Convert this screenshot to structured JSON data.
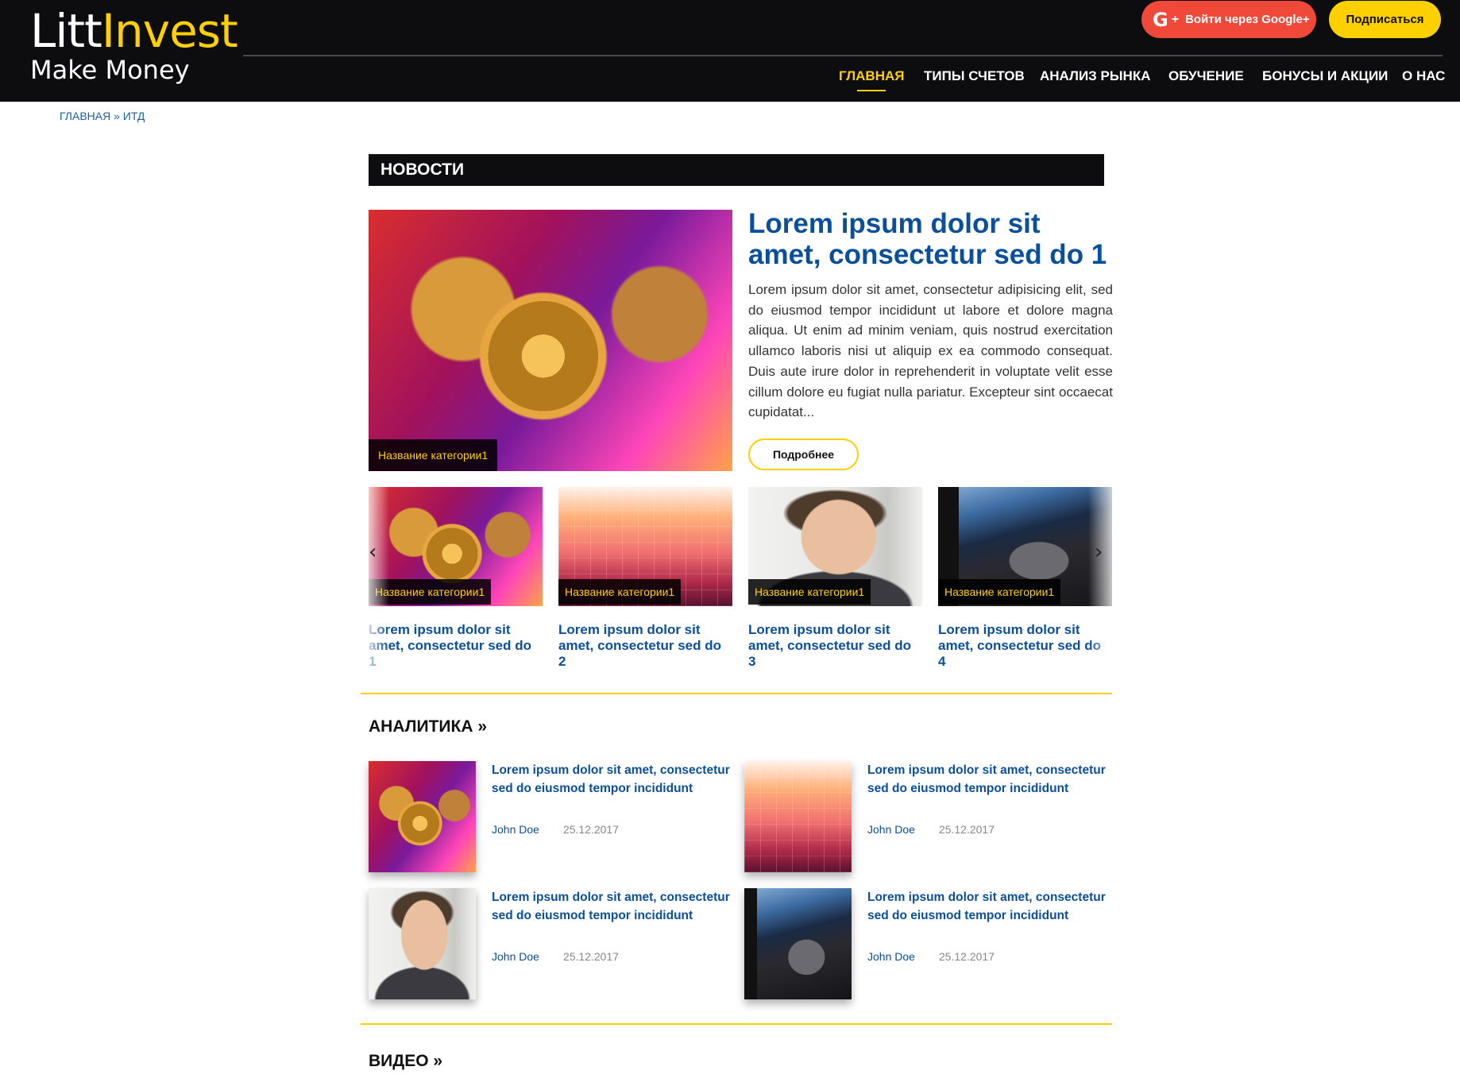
{
  "header": {
    "logo_main_1": "Litt",
    "logo_main_2": "Invest",
    "logo_sub": "Make Money",
    "google_label": "Войти через Google+",
    "google_g": "G",
    "google_plus": "+",
    "subscribe_label": "Подписаться",
    "nav": [
      {
        "label": "ГЛАВНАЯ",
        "active": true
      },
      {
        "label": "ТИПЫ СЧЕТОВ"
      },
      {
        "label": "АНАЛИЗ РЫНКА"
      },
      {
        "label": "ОБУЧЕНИЕ"
      },
      {
        "label": "БОНУСЫ И АКЦИИ"
      },
      {
        "label": "О НАС"
      }
    ]
  },
  "breadcrumb": "ГЛАВНАЯ » ИТД",
  "news": {
    "section_title": "НОВОСТИ",
    "featured": {
      "category": "Название категории1",
      "title": "Lorem ipsum dolor sit amet, consectetur sed do 1",
      "text": "Lorem ipsum dolor sit amet, consectetur adipisicing elit, sed do eiusmod tempor incididunt ut labore et dolore magna aliqua. Ut enim ad minim veniam, quis nostrud exercitation ullamco laboris nisi ut aliquip ex ea commodo consequat. Duis aute irure dolor in reprehenderit in voluptate velit esse cillum dolore eu fugiat nulla pariatur. Excepteur sint occaecat cupidatat...",
      "button": "Подробнее"
    },
    "carousel": [
      {
        "category": "Название категории1",
        "title": "Lorem ipsum dolor sit amet, consectetur sed do 1",
        "image": "bitcoin-coins"
      },
      {
        "category": "Название категории1",
        "title": "Lorem ipsum dolor sit amet, consectetur sed do 2",
        "image": "world-map-chart"
      },
      {
        "category": "Название категории1",
        "title": "Lorem ipsum dolor sit amet, consectetur sed do 3",
        "image": "man-with-glasses"
      },
      {
        "category": "Название категории1",
        "title": "Lorem ipsum dolor sit amet, consectetur sed do 4",
        "image": "att-building"
      }
    ],
    "arrow_prev": "‹",
    "arrow_next": "›"
  },
  "analytics": {
    "section_title": "АНАЛИТИКА »",
    "items": [
      {
        "title": "Lorem ipsum dolor sit amet, consectetur sed do eiusmod tempor incididunt",
        "author": "John Doe",
        "date": "25.12.2017",
        "image": "bitcoin-coins"
      },
      {
        "title": "Lorem ipsum dolor sit amet, consectetur sed do eiusmod tempor incididunt",
        "author": "John Doe",
        "date": "25.12.2017",
        "image": "world-map-chart"
      },
      {
        "title": "Lorem ipsum dolor sit amet, consectetur sed do eiusmod tempor incididunt",
        "author": "John Doe",
        "date": "25.12.2017",
        "image": "man-with-glasses"
      },
      {
        "title": "Lorem ipsum dolor sit amet, consectetur sed do eiusmod tempor incididunt",
        "author": "John Doe",
        "date": "25.12.2017",
        "image": "att-building"
      }
    ]
  },
  "video": {
    "section_title": "ВИДЕО »"
  },
  "colors": {
    "header_bg": "#0d0d0f",
    "accent_yellow": "#ffd000",
    "link_blue": "#0a4f9c",
    "google_red": "#f0493a"
  }
}
